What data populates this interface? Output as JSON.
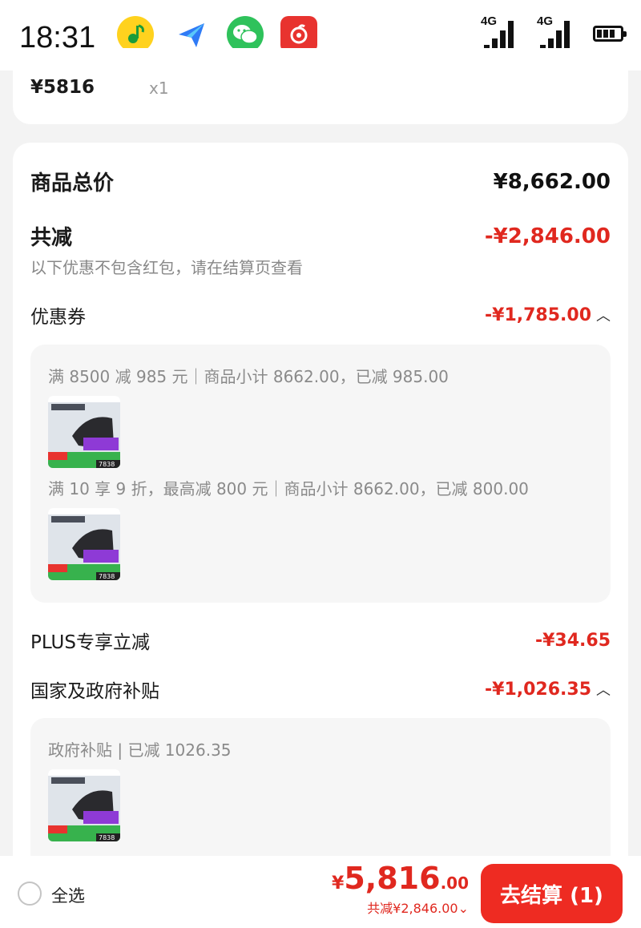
{
  "status_bar": {
    "time": "18:31",
    "apps": [
      "qq-music-icon",
      "feishu-icon",
      "wechat-icon",
      "netease-music-icon"
    ],
    "network_1": "4G",
    "network_2": "4G"
  },
  "item": {
    "price": "¥5816",
    "qty": "x1"
  },
  "summary": {
    "total_label": "商品总价",
    "total_value": "¥8,662.00",
    "discount_label": "共减",
    "discount_value": "-¥2,846.00",
    "note": "以下优惠不包含红包，请在结算页查看"
  },
  "coupon": {
    "label": "优惠券",
    "value": "-¥1,785.00",
    "chevron": "^",
    "rules": [
      "满 8500 减 985 元｜商品小计 8662.00，已减 985.00",
      "满 10 享 9 折，最高减 800 元｜商品小计 8662.00，已减 800.00"
    ]
  },
  "plus": {
    "label": "PLUS专享立减",
    "value": "-¥34.65"
  },
  "gov": {
    "label": "国家及政府补贴",
    "value": "-¥1,026.35",
    "chevron": "^",
    "rule": "政府补贴 | 已减 1026.35"
  },
  "thumbnail": {
    "price_tag": "7838",
    "badge": "15%"
  },
  "bottom": {
    "select_all": "全选",
    "yen": "¥",
    "total_int": "5,816",
    "total_dec": ".00",
    "saved": "共减¥2,846.00",
    "saved_chevron": "⌄",
    "checkout": "去结算 (1)"
  },
  "colors": {
    "accent_red": "#e0281f",
    "button_red": "#ee2b22",
    "page_bg": "#f3f3f3"
  }
}
